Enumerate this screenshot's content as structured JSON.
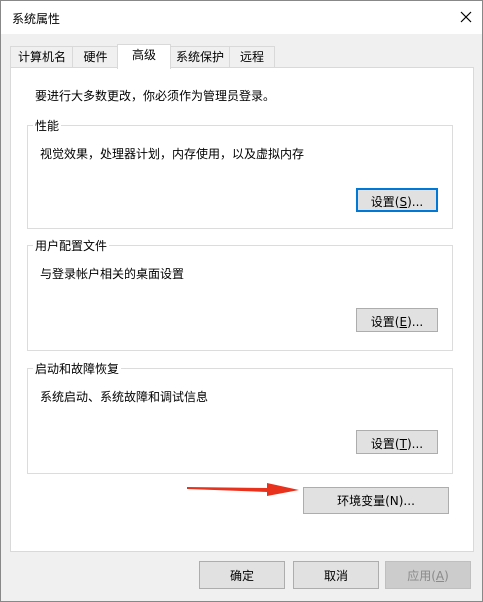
{
  "window": {
    "title": "系统属性"
  },
  "tabs": [
    {
      "label": "计算机名"
    },
    {
      "label": "硬件"
    },
    {
      "label": "高级"
    },
    {
      "label": "系统保护"
    },
    {
      "label": "远程"
    }
  ],
  "advanced": {
    "intro": "要进行大多数更改，你必须作为管理员登录。",
    "performance": {
      "title": "性能",
      "description": "视觉效果，处理器计划，内存使用，以及虚拟内存",
      "button_prefix": "设置(",
      "button_key": "S",
      "button_suffix": ")..."
    },
    "user_profiles": {
      "title": "用户配置文件",
      "description": "与登录帐户相关的桌面设置",
      "button_prefix": "设置(",
      "button_key": "E",
      "button_suffix": ")..."
    },
    "startup_recovery": {
      "title": "启动和故障恢复",
      "description": "系统启动、系统故障和调试信息",
      "button_prefix": "设置(",
      "button_key": "T",
      "button_suffix": ")..."
    },
    "env_button": "环境变量(N)..."
  },
  "footer": {
    "ok": "确定",
    "cancel": "取消",
    "apply_prefix": "应用(",
    "apply_key": "A",
    "apply_suffix": ")"
  },
  "colors": {
    "annotation_arrow": "#e8321e",
    "focus": "#0078d7"
  }
}
